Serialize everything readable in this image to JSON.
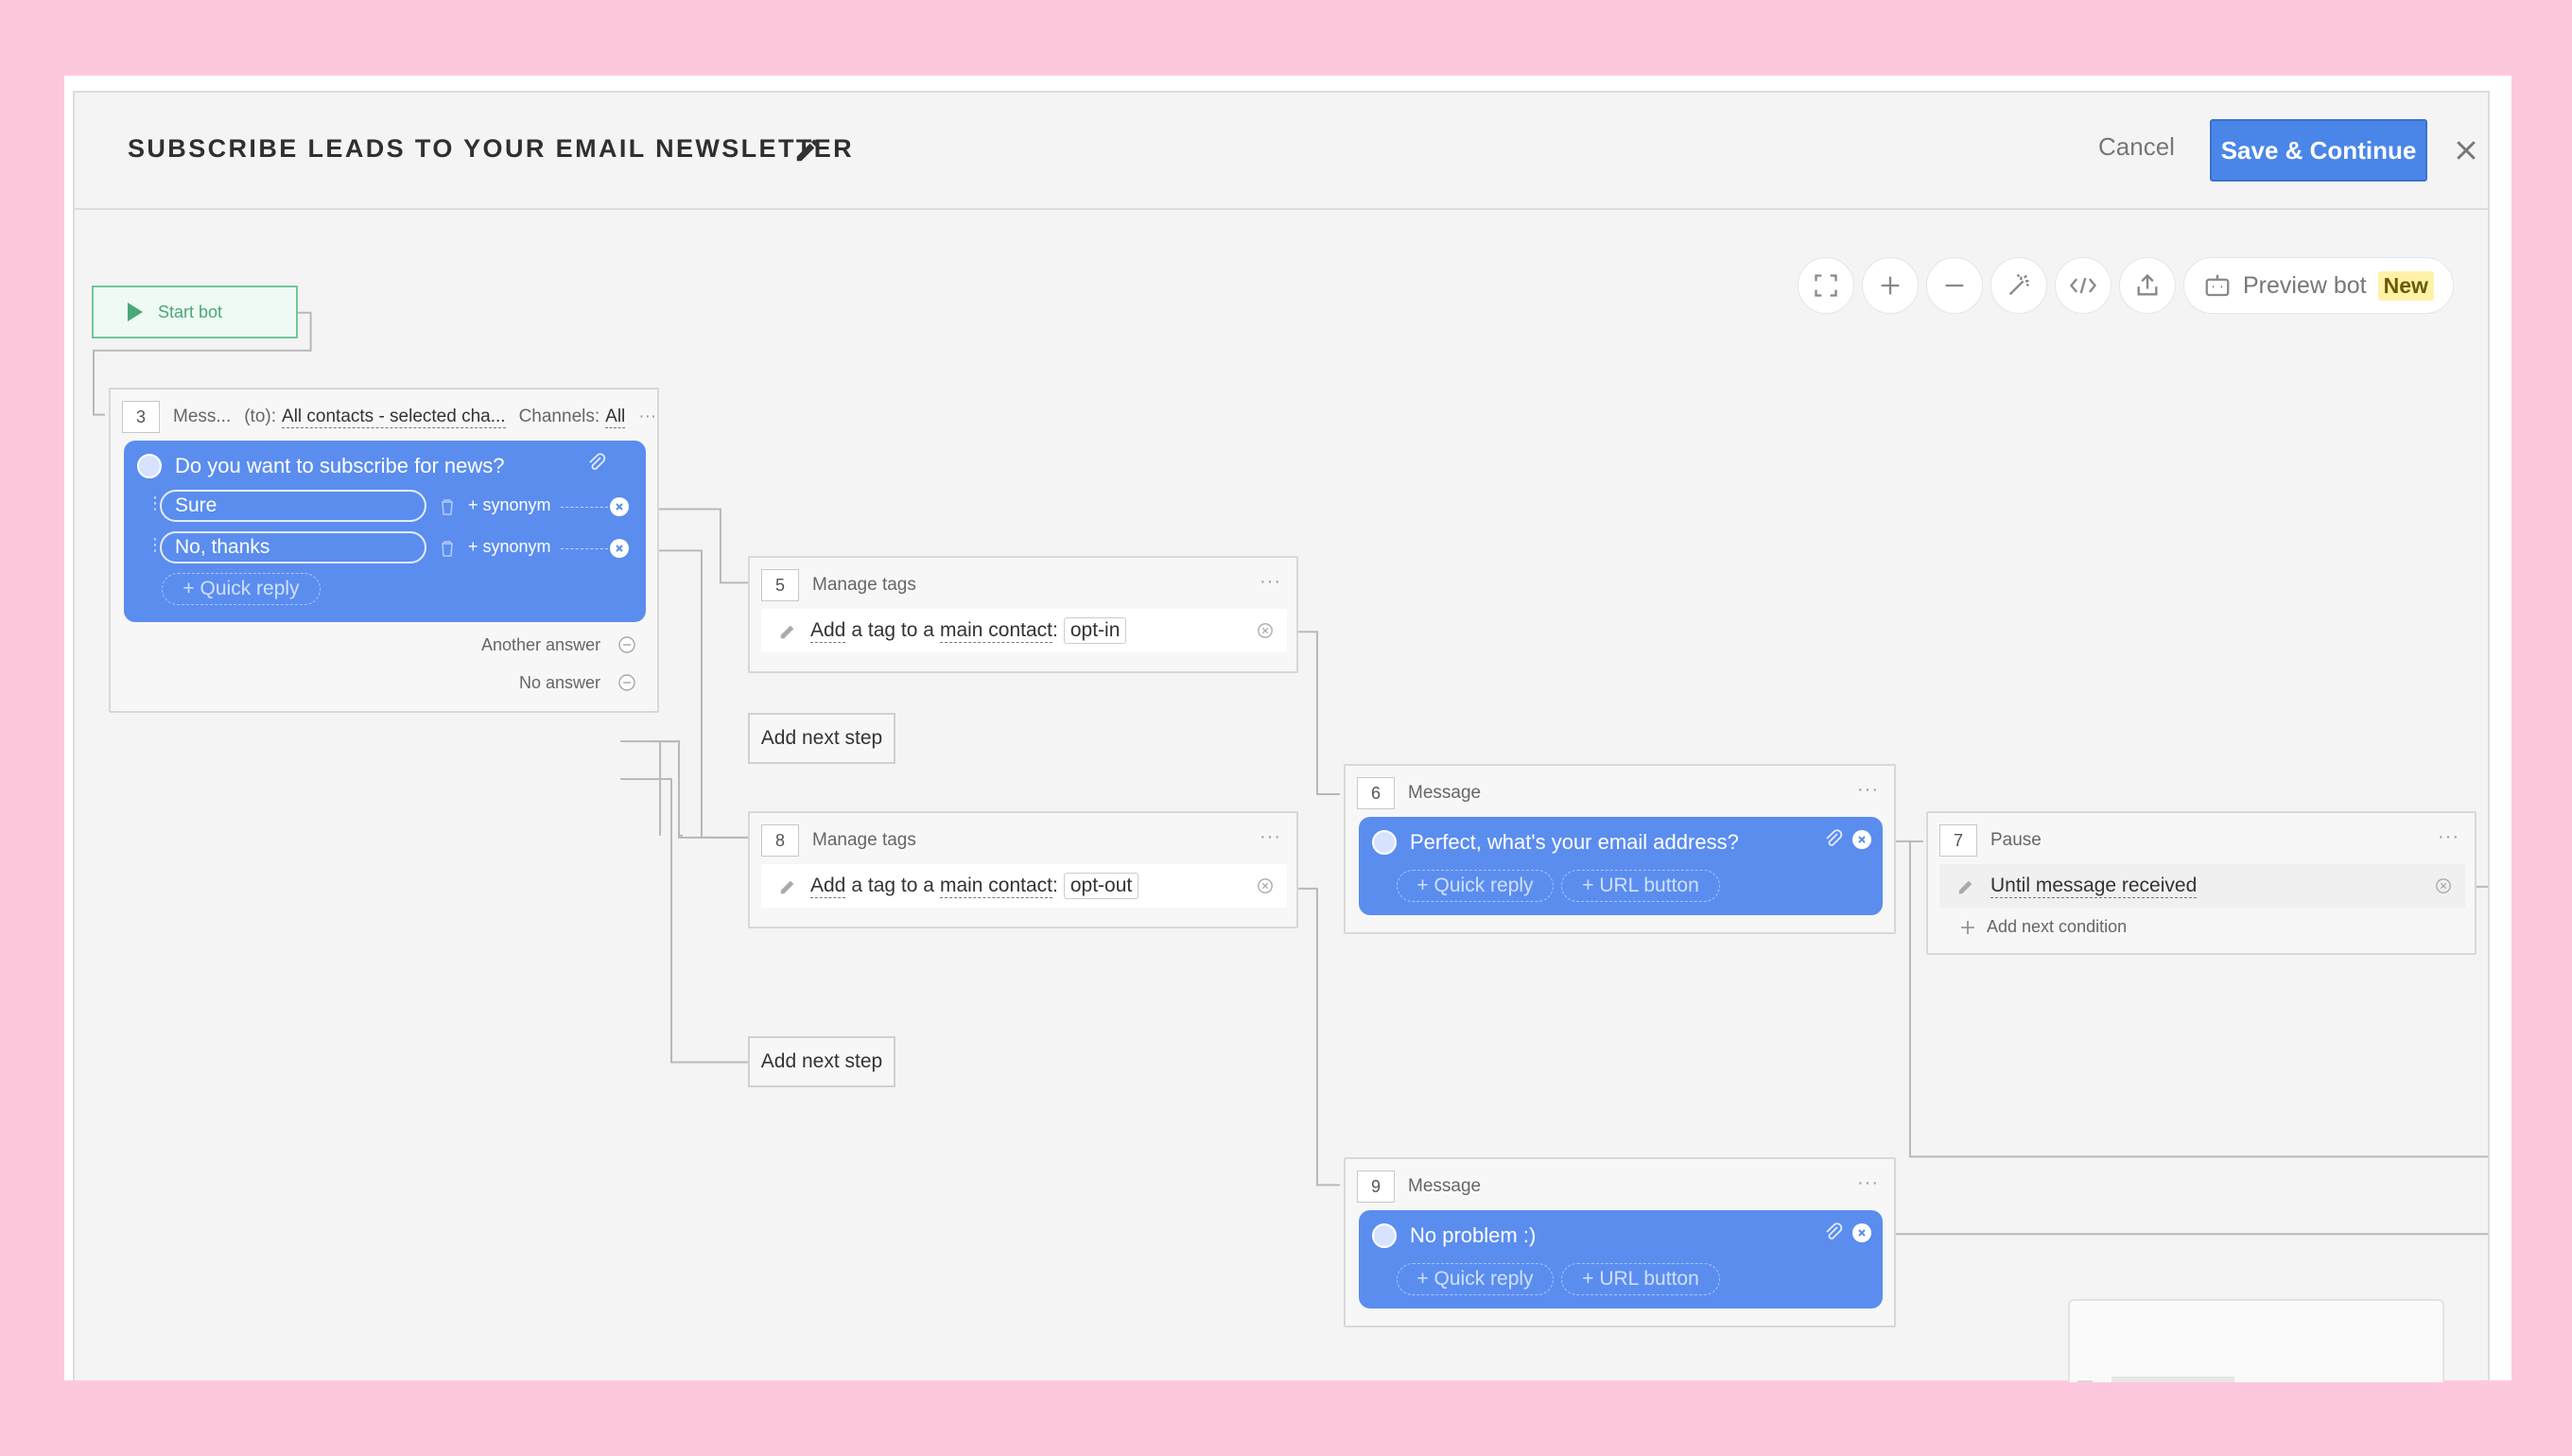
{
  "header": {
    "title": "SUBSCRIBE LEADS TO YOUR EMAIL NEWSLETTER",
    "cancel_label": "Cancel",
    "save_label": "Save & Continue"
  },
  "toolbar": {
    "icons": [
      "fullscreen-icon",
      "plus-icon",
      "minus-icon",
      "magic-wand-icon",
      "code-icon",
      "export-icon"
    ],
    "preview_label": "Preview bot",
    "preview_badge": "New"
  },
  "start_bot": {
    "label": "Start bot"
  },
  "node3": {
    "num": "3",
    "type": "Mess...",
    "to_label": "(to):",
    "to_value": "All contacts - selected cha...",
    "channels_label": "Channels:",
    "channels_value": "All",
    "dots": "···",
    "message": "Do you want to subscribe for news?",
    "replies": [
      {
        "label": "Sure",
        "synonym": "+ synonym"
      },
      {
        "label": "No, thanks",
        "synonym": "+ synonym"
      }
    ],
    "quick_reply": "+ Quick reply",
    "another_answer": "Another answer",
    "no_answer": "No answer"
  },
  "node5": {
    "num": "5",
    "title": "Manage tags",
    "dots": "···",
    "action_prefix": "Add",
    "action_mid": "a tag to a",
    "action_target": "main contact",
    "colon": ":",
    "tag": "opt-in"
  },
  "node8": {
    "num": "8",
    "title": "Manage tags",
    "dots": "···",
    "action_prefix": "Add",
    "action_mid": "a tag to a",
    "action_target": "main contact",
    "colon": ":",
    "tag": "opt-out"
  },
  "add_next_step": "Add next step",
  "node6": {
    "num": "6",
    "title": "Message",
    "dots": "···",
    "message": "Perfect, what's your email address?",
    "quick_reply": "+ Quick reply",
    "url_button": "+ URL button"
  },
  "node7": {
    "num": "7",
    "title": "Pause",
    "dots": "···",
    "condition": "Until message received",
    "add_condition": "Add next condition"
  },
  "node9": {
    "num": "9",
    "title": "Message",
    "dots": "···",
    "message": "No problem :)",
    "quick_reply": "+ Quick reply",
    "url_button": "+ URL button"
  },
  "colors": {
    "accent": "#4a86e8",
    "bubble": "#5b8def",
    "start_green": "#6fc89a",
    "badge_yellow": "#fff2a8",
    "background_pink": "#fdc8dd"
  }
}
